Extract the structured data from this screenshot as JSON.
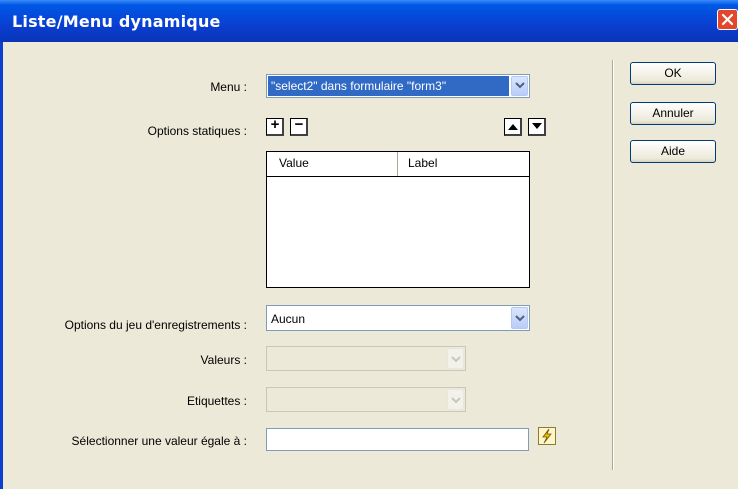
{
  "window": {
    "title": "Liste/Menu dynamique"
  },
  "form": {
    "menu_label": "Menu :",
    "menu_value": "\"select2\" dans formulaire \"form3\"",
    "options_statiques_label": "Options statiques :",
    "add_symbol": "+",
    "remove_symbol": "−",
    "columns": [
      "Value",
      "Label"
    ],
    "rows": [],
    "recordset_label": "Options du jeu d'enregistrements :",
    "recordset_value": "Aucun",
    "valeurs_label": "Valeurs :",
    "valeurs_value": "",
    "etiquettes_label": "Etiquettes :",
    "etiquettes_value": "",
    "select_value_label": "Sélectionner une valeur égale à :",
    "select_value_value": ""
  },
  "buttons": {
    "ok": "OK",
    "annuler": "Annuler",
    "aide": "Aide"
  },
  "icons": {
    "close": "close-icon",
    "move_up": "triangle-up-icon",
    "move_down": "triangle-down-icon",
    "dynamic_data": "lightning-bolt-icon"
  },
  "colors": {
    "titlebar": "#0a3fd1",
    "dialog_bg": "#ece9d8",
    "close_button": "#e2462c"
  }
}
